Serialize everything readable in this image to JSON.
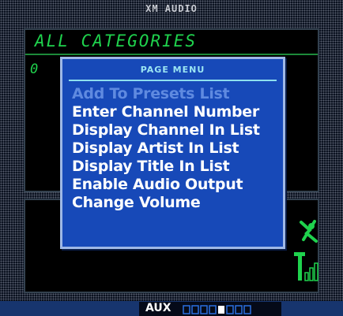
{
  "screen": {
    "title": "XM AUDIO",
    "category": "ALL CATEGORIES",
    "channel_number": "0"
  },
  "page_menu": {
    "title": "PAGE MENU",
    "items": [
      {
        "label": "Add To Presets List",
        "enabled": false
      },
      {
        "label": "Enter Channel Number",
        "enabled": true
      },
      {
        "label": "Display Channel In List",
        "enabled": true
      },
      {
        "label": "Display Artist In List",
        "enabled": true
      },
      {
        "label": "Display Title In List",
        "enabled": true
      },
      {
        "label": "Enable Audio Output",
        "enabled": true
      },
      {
        "label": "Change Volume",
        "enabled": true
      }
    ]
  },
  "status_bar": {
    "mode_label": "AUX",
    "level_segments_total": 8,
    "level_highlighted_segment": 5
  },
  "icons": {
    "mute": "antenna-muted-icon",
    "signal": "signal-strength-icon"
  },
  "colors": {
    "menu_background": "#1749b8",
    "menu_border": "#9fb8e6",
    "menu_title": "#9be5f3",
    "menu_item_enabled": "#ffffff",
    "menu_item_disabled": "#5f8ae0",
    "screen_text_green": "#1fd24d",
    "status_bar": "#17356e"
  }
}
